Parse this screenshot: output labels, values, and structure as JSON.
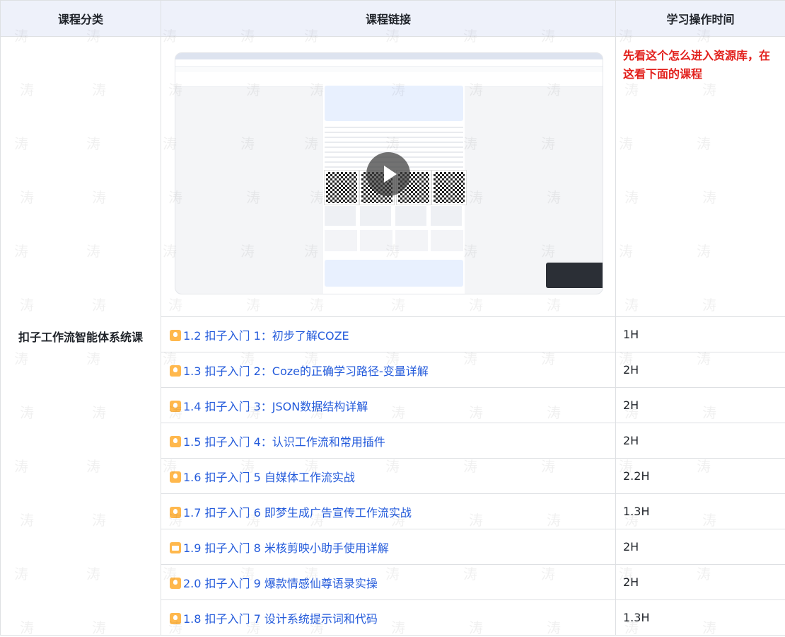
{
  "header": {
    "col_category": "课程分类",
    "col_link": "课程链接",
    "col_time": "学习操作时间"
  },
  "category": "扣子工作流智能体系统课",
  "note": "先看这个怎么进入资源库，在这看下面的课程",
  "courses": [
    {
      "title": "1.2  扣子入门 1：初步了解COZE",
      "time": "1H",
      "icon": "lightbulb-icon"
    },
    {
      "title": "1.3 扣子入门 2：Coze的正确学习路径-变量详解",
      "time": "2H",
      "icon": "lightbulb-icon"
    },
    {
      "title": "1.4 扣子入门 3：JSON数据结构详解",
      "time": "2H",
      "icon": "lightbulb-icon"
    },
    {
      "title": "1.5 扣子入门 4：认识工作流和常用插件",
      "time": "2H",
      "icon": "lightbulb-icon"
    },
    {
      "title": "1.6 扣子入门 5  自媒体工作流实战",
      "time": "2.2H",
      "icon": "lightbulb-icon"
    },
    {
      "title": "1.7 扣子入门 6 即梦生成广告宣传工作流实战",
      "time": "1.3H",
      "icon": "lightbulb-icon"
    },
    {
      "title": "1.9 扣子入门 8 米核剪映小助手使用详解",
      "time": "2H",
      "icon": "video-icon"
    },
    {
      "title": "2.0 扣子入门 9 爆款情感仙尊语录实操",
      "time": "2H",
      "icon": "lightbulb-icon"
    },
    {
      "title": "1.8 扣子入门 7  设计系统提示词和代码",
      "time": "1.3H",
      "icon": "lightbulb-icon"
    }
  ],
  "watermark": "涛",
  "colors": {
    "link": "#245bdb",
    "note": "#e2201c",
    "header_bg": "#eef1fa",
    "icon": "#ffb84d"
  }
}
